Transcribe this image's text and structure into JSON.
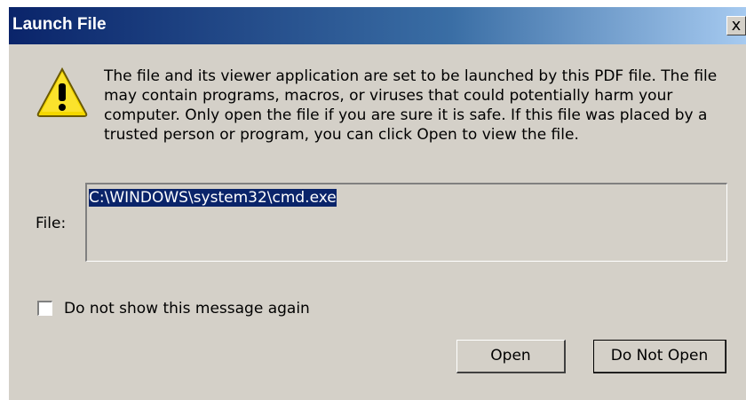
{
  "window": {
    "title": "Launch File",
    "close_glyph": "x"
  },
  "icons": {
    "warning": "warning-icon",
    "close": "close-icon"
  },
  "message": "The file and its viewer application are set to be launched by this PDF file. The file may contain programs, macros, or viruses that could potentially harm your computer. Only open the file if you are sure it is safe. If this file was placed by a trusted person or program, you can click Open to view the file.",
  "file": {
    "label": "File:",
    "value": "C:\\WINDOWS\\system32\\cmd.exe"
  },
  "checkbox": {
    "label": "Do not show this message again",
    "checked": false
  },
  "buttons": {
    "open": "Open",
    "do_not_open": "Do Not Open"
  },
  "colors": {
    "titlebar_start": "#0a246a",
    "titlebar_end": "#a6caf0",
    "dialog_bg": "#d4d0c8",
    "selection": "#0a246a",
    "warning": "#f5d800"
  }
}
